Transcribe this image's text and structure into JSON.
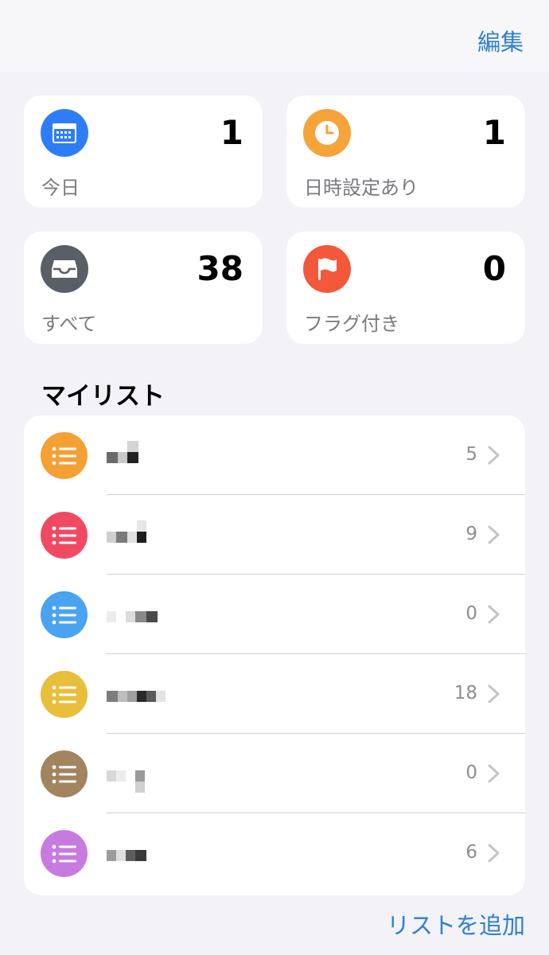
{
  "nav": {
    "edit_label": "編集"
  },
  "smart_lists": [
    {
      "label": "今日",
      "count": "1",
      "color": "#2f7df6",
      "icon": "calendar-icon"
    },
    {
      "label": "日時設定あり",
      "count": "1",
      "color": "#f6a33a",
      "icon": "clock-icon"
    },
    {
      "label": "すべて",
      "count": "38",
      "color": "#5a5e66",
      "icon": "tray-icon"
    },
    {
      "label": "フラグ付き",
      "count": "0",
      "color": "#f4583a",
      "icon": "flag-icon"
    }
  ],
  "my_lists": {
    "title": "マイリスト",
    "items": [
      {
        "count": "5",
        "color": "#f5a035",
        "icon": "list-icon"
      },
      {
        "count": "9",
        "color": "#f04a63",
        "icon": "list-icon"
      },
      {
        "count": "0",
        "color": "#4aa3f0",
        "icon": "list-icon"
      },
      {
        "count": "18",
        "color": "#e9be3b",
        "icon": "list-icon"
      },
      {
        "count": "0",
        "color": "#a2845e",
        "icon": "list-icon"
      },
      {
        "count": "6",
        "color": "#c77ae0",
        "icon": "list-icon"
      }
    ]
  },
  "footer": {
    "add_list_label": "リストを追加"
  }
}
